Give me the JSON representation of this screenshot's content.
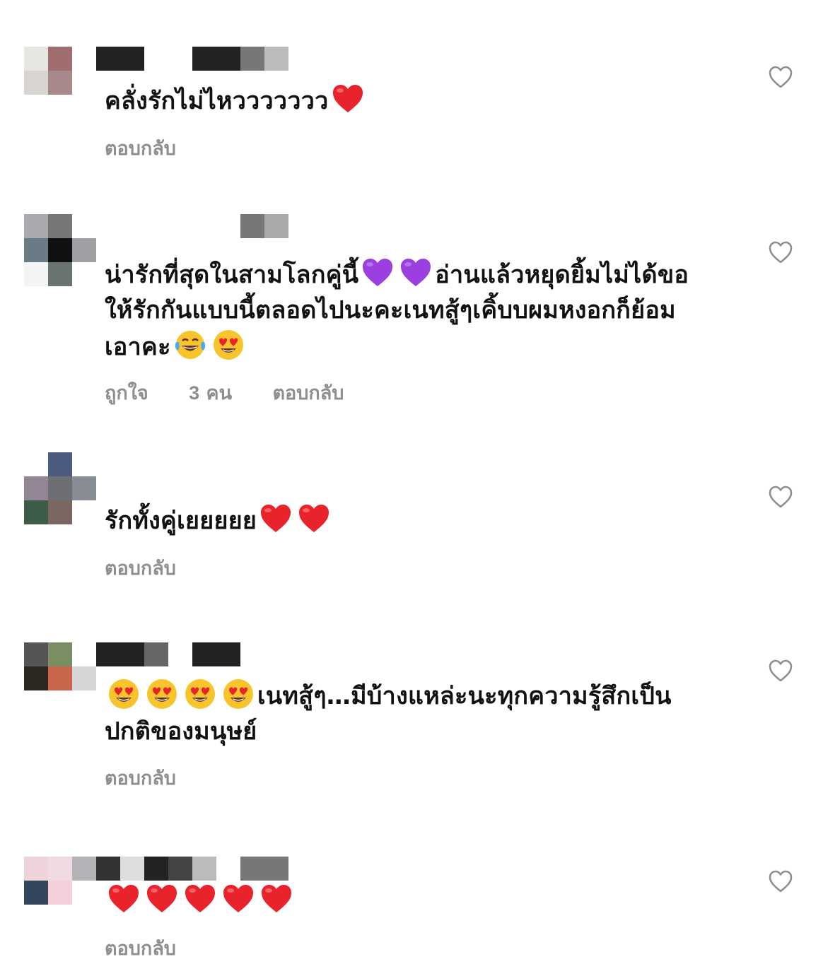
{
  "comments": [
    {
      "text": "คลั่งรักไม่ไหววววววว",
      "emojis_after": [
        "red-heart"
      ],
      "reply_label": "ตอบกลับ"
    },
    {
      "text_part1": "น่ารักที่สุดในสามโลกคู่นี้",
      "text_part2": "อ่านแล้วหยุดยิ้มไม่ได้ขอ",
      "text_line2": "ให้รักกันแบบนี้ตลอดไปนะคะเนทสู้ๆเคิ้บบผมหงอกก็ย้อม",
      "text_line3": "เอาคะ",
      "likes_prefix": "ถูกใจ",
      "likes_count": "3",
      "likes_suffix": "คน",
      "reply_label": "ตอบกลับ"
    },
    {
      "text": "รักทั้งคู่เยยยยย",
      "emojis_after": [
        "red-heart",
        "red-heart"
      ],
      "reply_label": "ตอบกลับ"
    },
    {
      "text_line1": "เนทสู้ๆ…มีบ้างแหล่ะนะทุกความรู้สึกเป็น",
      "text_line2": "ปกติของมนุษย์",
      "reply_label": "ตอบกลับ"
    },
    {
      "emojis": [
        "red-heart",
        "red-heart",
        "red-heart",
        "red-heart",
        "red-heart"
      ],
      "reply_label": "ตอบกลับ"
    }
  ],
  "icons": {
    "like": "heart-outline-icon",
    "red_heart": "red-heart-emoji",
    "purple_heart": "purple-heart-emoji",
    "laughing": "face-with-tears-of-joy-emoji",
    "heart_eyes": "heart-eyes-emoji"
  },
  "colors": {
    "meta_text": "#8e8e8e",
    "red_heart": "#e8232b",
    "purple_heart": "#9b3fe0"
  }
}
